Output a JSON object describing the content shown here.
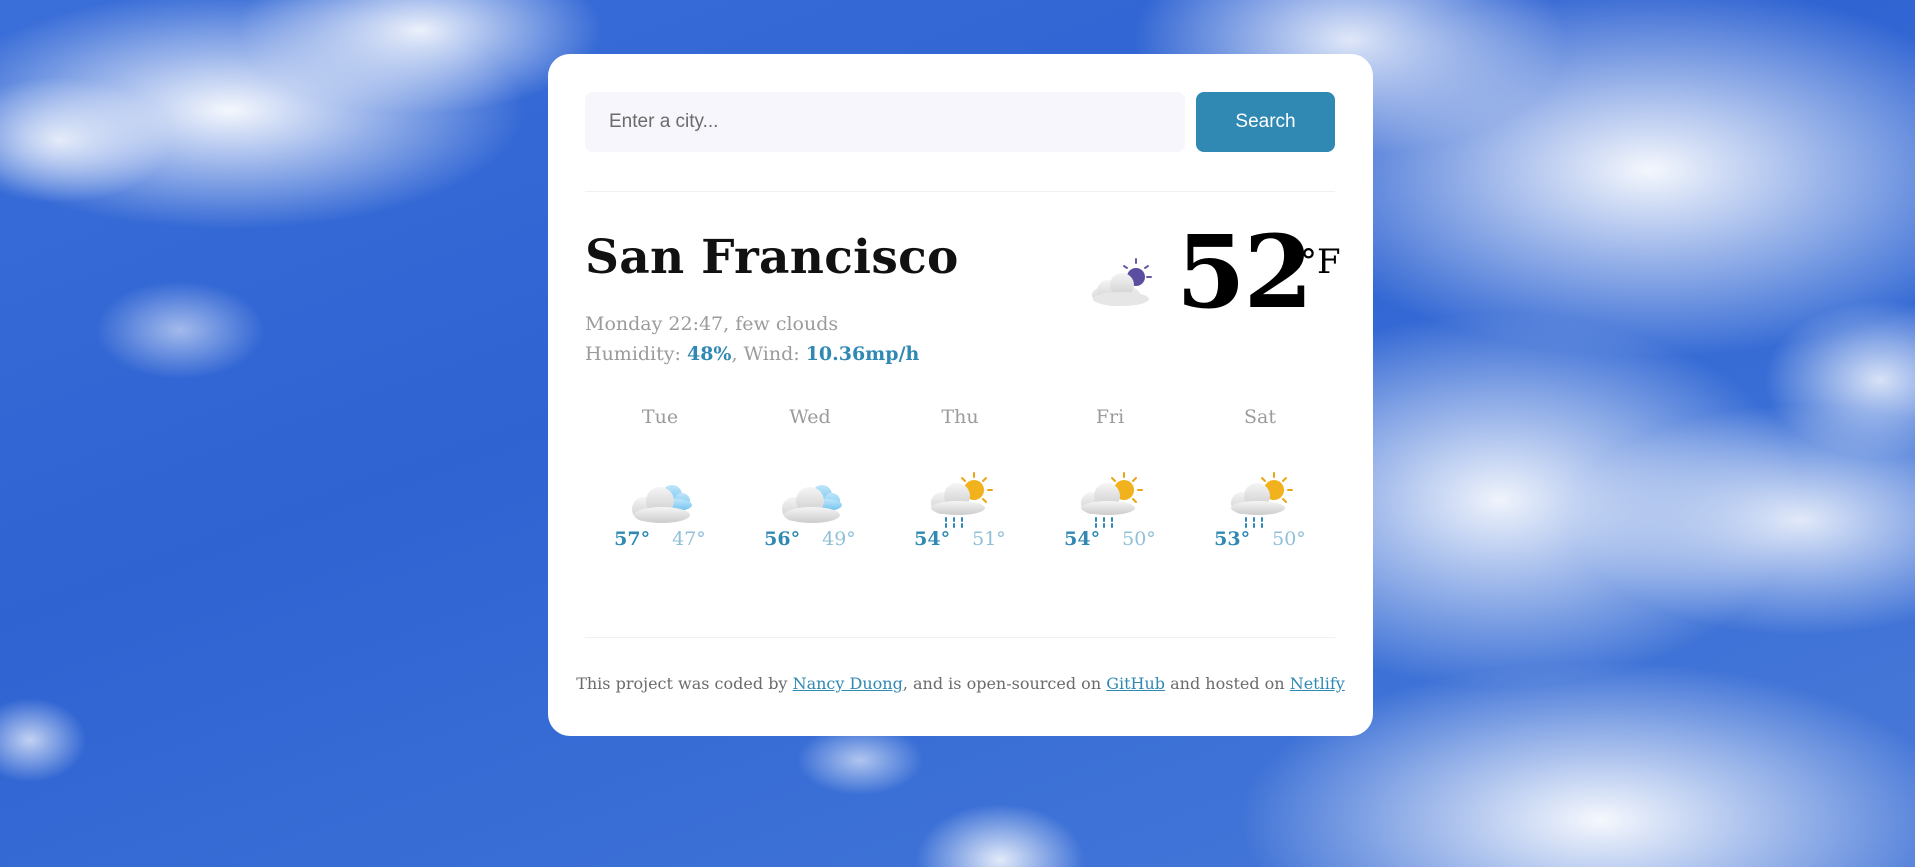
{
  "search": {
    "placeholder": "Enter a city...",
    "value": "",
    "button_label": "Search"
  },
  "current": {
    "city": "San Francisco",
    "day_time": "Monday 22:47",
    "description": "few clouds",
    "humidity_label": "Humidity:",
    "humidity": "48%",
    "wind_label": "Wind:",
    "wind": "10.36mp/h",
    "temperature": "52",
    "unit": "°F",
    "icon": "few-clouds-night-icon"
  },
  "forecast": [
    {
      "day": "Tue",
      "max": "57°",
      "min": "47°",
      "icon": "cloudy-icon"
    },
    {
      "day": "Wed",
      "max": "56°",
      "min": "49°",
      "icon": "cloudy-icon"
    },
    {
      "day": "Thu",
      "max": "54°",
      "min": "51°",
      "icon": "rain-sun-icon"
    },
    {
      "day": "Fri",
      "max": "54°",
      "min": "50°",
      "icon": "rain-sun-icon"
    },
    {
      "day": "Sat",
      "max": "53°",
      "min": "50°",
      "icon": "rain-sun-icon"
    }
  ],
  "footer": {
    "text_1": "This project was coded by ",
    "author": "Nancy Duong",
    "text_2": ", and is open-sourced on ",
    "github": "GitHub",
    "text_3": " and hosted on ",
    "netlify": "Netlify"
  },
  "colors": {
    "accent": "#2f89b3",
    "muted": "#9b9b9b",
    "min_temp": "#8fc0d8",
    "input_bg": "#f7f6fd"
  }
}
